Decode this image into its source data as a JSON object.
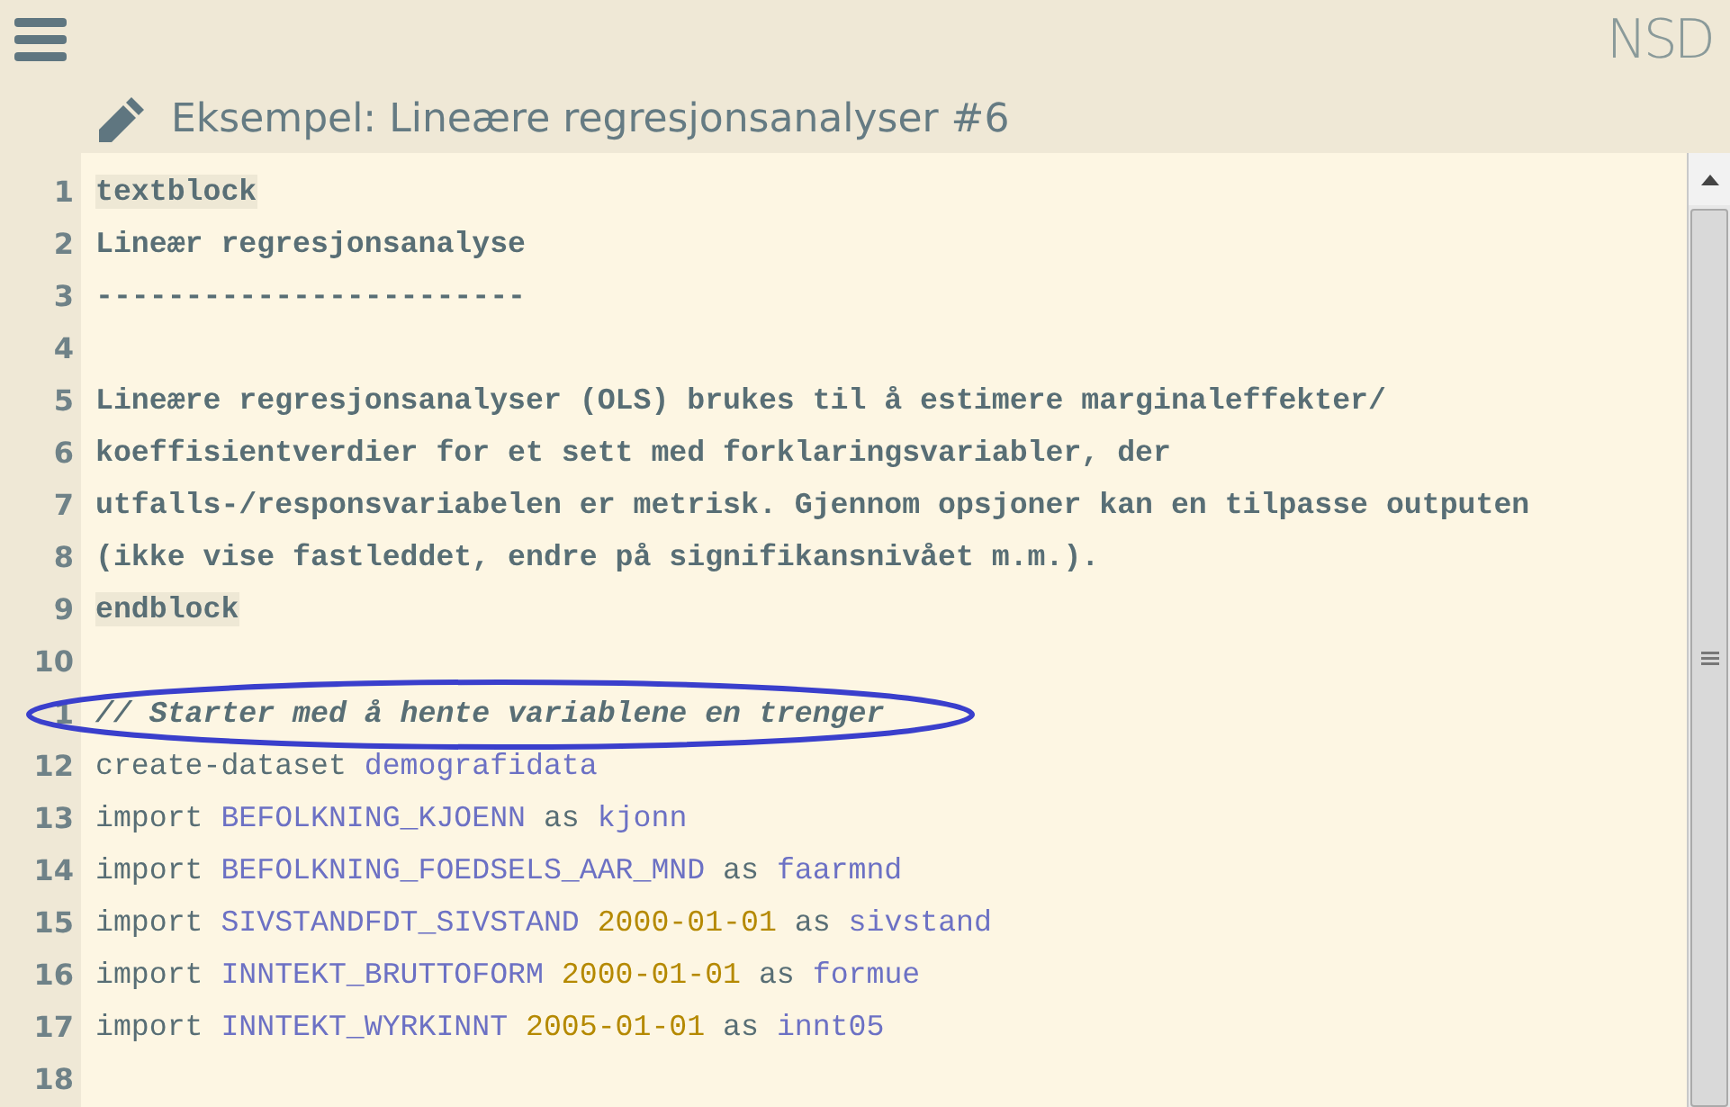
{
  "header": {
    "logo": "NSD",
    "title": "Eksempel: Lineære regresjonsanalyser #6"
  },
  "lines": [
    {
      "number": "1",
      "circled": false,
      "tokens": [
        {
          "kind": "block",
          "text": "textblock"
        }
      ]
    },
    {
      "number": "2",
      "circled": false,
      "tokens": [
        {
          "kind": "text",
          "text": "Lineær regresjonsanalyse"
        }
      ]
    },
    {
      "number": "3",
      "circled": false,
      "tokens": [
        {
          "kind": "text",
          "text": "------------------------"
        }
      ]
    },
    {
      "number": "4",
      "circled": false
    },
    {
      "number": "5",
      "circled": false,
      "tokens": [
        {
          "kind": "text",
          "text": "Lineære regresjonsanalyser (OLS) brukes til å estimere marginaleffekter/"
        }
      ]
    },
    {
      "number": "6",
      "circled": false,
      "tokens": [
        {
          "kind": "text",
          "text": "koeffisientverdier for et sett med forklaringsvariabler, der"
        }
      ]
    },
    {
      "number": "7",
      "circled": false,
      "tokens": [
        {
          "kind": "text",
          "text": "utfalls-/responsvariabelen er metrisk. Gjennom opsjoner kan en tilpasse outputen"
        }
      ]
    },
    {
      "number": "8",
      "circled": false,
      "tokens": [
        {
          "kind": "text",
          "text": "(ikke vise fastleddet, endre på signifikansnivået m.m.)."
        }
      ]
    },
    {
      "number": "9",
      "circled": false,
      "tokens": [
        {
          "kind": "block",
          "text": "endblock"
        }
      ]
    },
    {
      "number": "10",
      "circled": false
    },
    {
      "number": "1",
      "circled": true,
      "tokens": [
        {
          "kind": "comment",
          "text": "// Starter med å hente variablene en trenger"
        }
      ]
    },
    {
      "number": "12",
      "circled": false,
      "tokens": [
        {
          "kind": "cmd",
          "text": "create-dataset "
        },
        {
          "kind": "var",
          "text": "demografidata"
        }
      ]
    },
    {
      "number": "13",
      "circled": false,
      "tokens": [
        {
          "kind": "cmd",
          "text": "import "
        },
        {
          "kind": "var",
          "text": "BEFOLKNING_KJOENN"
        },
        {
          "kind": "cmd",
          "text": " as "
        },
        {
          "kind": "var",
          "text": "kjonn"
        }
      ]
    },
    {
      "number": "14",
      "circled": false,
      "tokens": [
        {
          "kind": "cmd",
          "text": "import "
        },
        {
          "kind": "var",
          "text": "BEFOLKNING_FOEDSELS_AAR_MND"
        },
        {
          "kind": "cmd",
          "text": " as "
        },
        {
          "kind": "var",
          "text": "faarmnd"
        }
      ]
    },
    {
      "number": "15",
      "circled": false,
      "tokens": [
        {
          "kind": "cmd",
          "text": "import "
        },
        {
          "kind": "var",
          "text": "SIVSTANDFDT_SIVSTAND"
        },
        {
          "kind": "date",
          "text": " 2000-01-01"
        },
        {
          "kind": "cmd",
          "text": " as "
        },
        {
          "kind": "var",
          "text": "sivstand"
        }
      ]
    },
    {
      "number": "16",
      "circled": false,
      "tokens": [
        {
          "kind": "cmd",
          "text": "import "
        },
        {
          "kind": "var",
          "text": "INNTEKT_BRUTTOFORM"
        },
        {
          "kind": "date",
          "text": " 2000-01-01"
        },
        {
          "kind": "cmd",
          "text": " as "
        },
        {
          "kind": "var",
          "text": "formue"
        }
      ]
    },
    {
      "number": "17",
      "circled": false,
      "tokens": [
        {
          "kind": "cmd",
          "text": "import "
        },
        {
          "kind": "var",
          "text": "INNTEKT_WYRKINNT"
        },
        {
          "kind": "date",
          "text": " 2005-01-01"
        },
        {
          "kind": "cmd",
          "text": " as "
        },
        {
          "kind": "var",
          "text": "innt05"
        }
      ]
    },
    {
      "number": "18",
      "circled": false
    }
  ]
}
